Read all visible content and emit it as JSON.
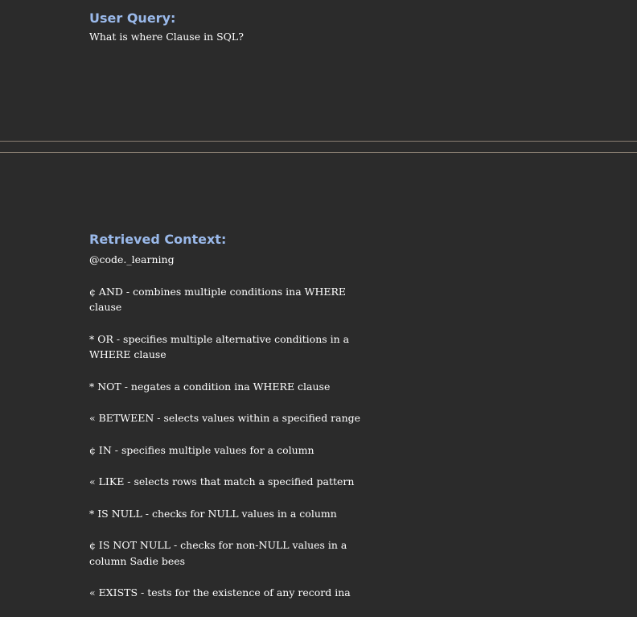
{
  "query": {
    "heading": "User Query:",
    "text": "What is where Clause in SQL?"
  },
  "context": {
    "heading": "Retrieved Context:",
    "source": "@code._learning",
    "items": [
      "¢ AND - combines multiple conditions ina WHERE clause",
      "* OR - specifies multiple alternative conditions in a WHERE clause",
      "* NOT - negates a condition ina WHERE clause",
      "« BETWEEN - selects values within a specified range",
      "¢ IN - specifies multiple values for a column",
      "« LIKE - selects rows that match a specified pattern",
      "* IS NULL - checks for NULL values in a column",
      "¢ IS NOT NULL - checks for non-NULL values in a column Sadie bees",
      "« EXISTS - tests for the existence of any record ina"
    ]
  },
  "colors": {
    "background": "#2b2b2b",
    "heading": "#9ab9ea",
    "text": "#ffffff",
    "divider": "#8a7f72"
  }
}
